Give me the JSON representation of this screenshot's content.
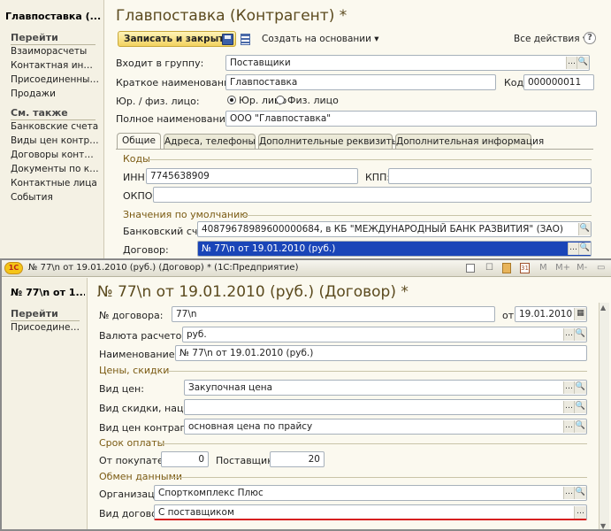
{
  "back": {
    "sidebar": {
      "title": "Главпоставка (...",
      "go_header": "Перейти",
      "go_items": [
        "Взаиморасчеты",
        "Контактная инфор...",
        "Присоединенные ф...",
        "Продажи"
      ],
      "see_header": "См. также",
      "see_items": [
        "Банковские счета",
        "Виды цен контраге...",
        "Договоры контраг...",
        "Документы по конт...",
        "Контактные лица",
        "События"
      ]
    },
    "title": "Главпоставка (Контрагент) *",
    "toolbar": {
      "save_close": "Записать и закрыть",
      "create_based": "Создать на основании ▾",
      "all_actions": "Все действия ▾",
      "help": "?"
    },
    "fields": {
      "group_label": "Входит в группу:",
      "group_value": "Поставщики",
      "short_label": "Краткое наименование:",
      "short_value": "Главпоставка",
      "code_label": "Код:",
      "code_value": "000000011",
      "type_label": "Юр. / физ. лицо:",
      "type_opt1": "Юр. лицо",
      "type_opt2": "Физ. лицо",
      "full_label": "Полное наименование:",
      "full_value": "ООО \"Главпоставка\""
    },
    "tabs": [
      "Общие",
      "Адреса, телефоны",
      "Дополнительные реквизиты",
      "Дополнительная информация"
    ],
    "codes": {
      "section": "Коды",
      "inn_label": "ИНН:",
      "inn_value": "7745638909",
      "kpp_label": "КПП:",
      "kpp_value": "",
      "okpo_label": "ОКПО:",
      "okpo_value": ""
    },
    "defaults": {
      "section": "Значения по умолчанию",
      "bank_label": "Банковский счет:",
      "bank_value": "40879678989600000684, в КБ \"МЕЖДУНАРОДНЫЙ БАНК РАЗВИТИЯ\" (ЗАО)",
      "contract_label": "Договор:",
      "contract_value": "№ 77\\n от 19.01.2010 (руб.)"
    }
  },
  "front": {
    "window_title": "№ 77\\n от 19.01.2010 (руб.) (Договор) * (1С:Предприятие)",
    "sidebar": {
      "title": "№ 77\\n от 1...",
      "go_header": "Перейти",
      "go_items": [
        "Присоединенн..."
      ]
    },
    "title": "№ 77\\n от 19.01.2010 (руб.) (Договор) *",
    "fields": {
      "num_label": "№ договора:",
      "num_value": "77\\n",
      "date_label": "от:",
      "date_value": "19.01.2010",
      "currency_label": "Валюта расчетов:",
      "currency_value": "руб.",
      "name_label": "Наименование:",
      "name_value": "№ 77\\n от 19.01.2010 (руб.)"
    },
    "prices": {
      "section": "Цены, скидки",
      "price_label": "Вид цен:",
      "price_value": "Закупочная цена",
      "discount_label": "Вид скидки, наценки:",
      "discount_value": "",
      "partner_price_label": "Вид цен контрагента:",
      "partner_price_value": "основная цена по прайсу"
    },
    "payment": {
      "section": "Срок оплаты",
      "buyer_label": "От покупателя:",
      "buyer_value": "0",
      "supplier_label": "Поставщику:",
      "supplier_value": "20"
    },
    "exchange": {
      "section": "Обмен данными",
      "org_label": "Организация:",
      "org_value": "Спорткомплекс Плюс",
      "kind_label": "Вид договора:",
      "kind_value": "С поставщиком"
    }
  }
}
